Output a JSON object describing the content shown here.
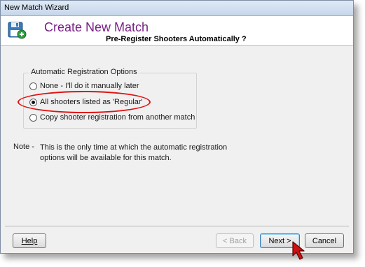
{
  "window": {
    "title": "New Match Wizard"
  },
  "header": {
    "icon": "floppy-disk-plus-icon",
    "title": "Create New Match",
    "subtitle": "Pre-Register Shooters Automatically ?",
    "title_color": "#7a1f86"
  },
  "options": {
    "legend": "Automatic Registration Options",
    "items": [
      {
        "label": "None - I'll do it manually later",
        "selected": false
      },
      {
        "label": "All shooters listed as 'Regular'",
        "selected": true
      },
      {
        "label": "Copy shooter registration from another match",
        "selected": false
      }
    ],
    "highlight_color": "#e01010"
  },
  "note": {
    "label": "Note -",
    "text_line1": "This is the only time at which the automatic registration",
    "text_line2": "options will be available for this match."
  },
  "buttons": {
    "help": "Help",
    "back": "< Back",
    "next": "Next >",
    "cancel": "Cancel"
  },
  "cursor": {
    "icon": "arrow-pointer-icon",
    "color": "#d01010"
  }
}
